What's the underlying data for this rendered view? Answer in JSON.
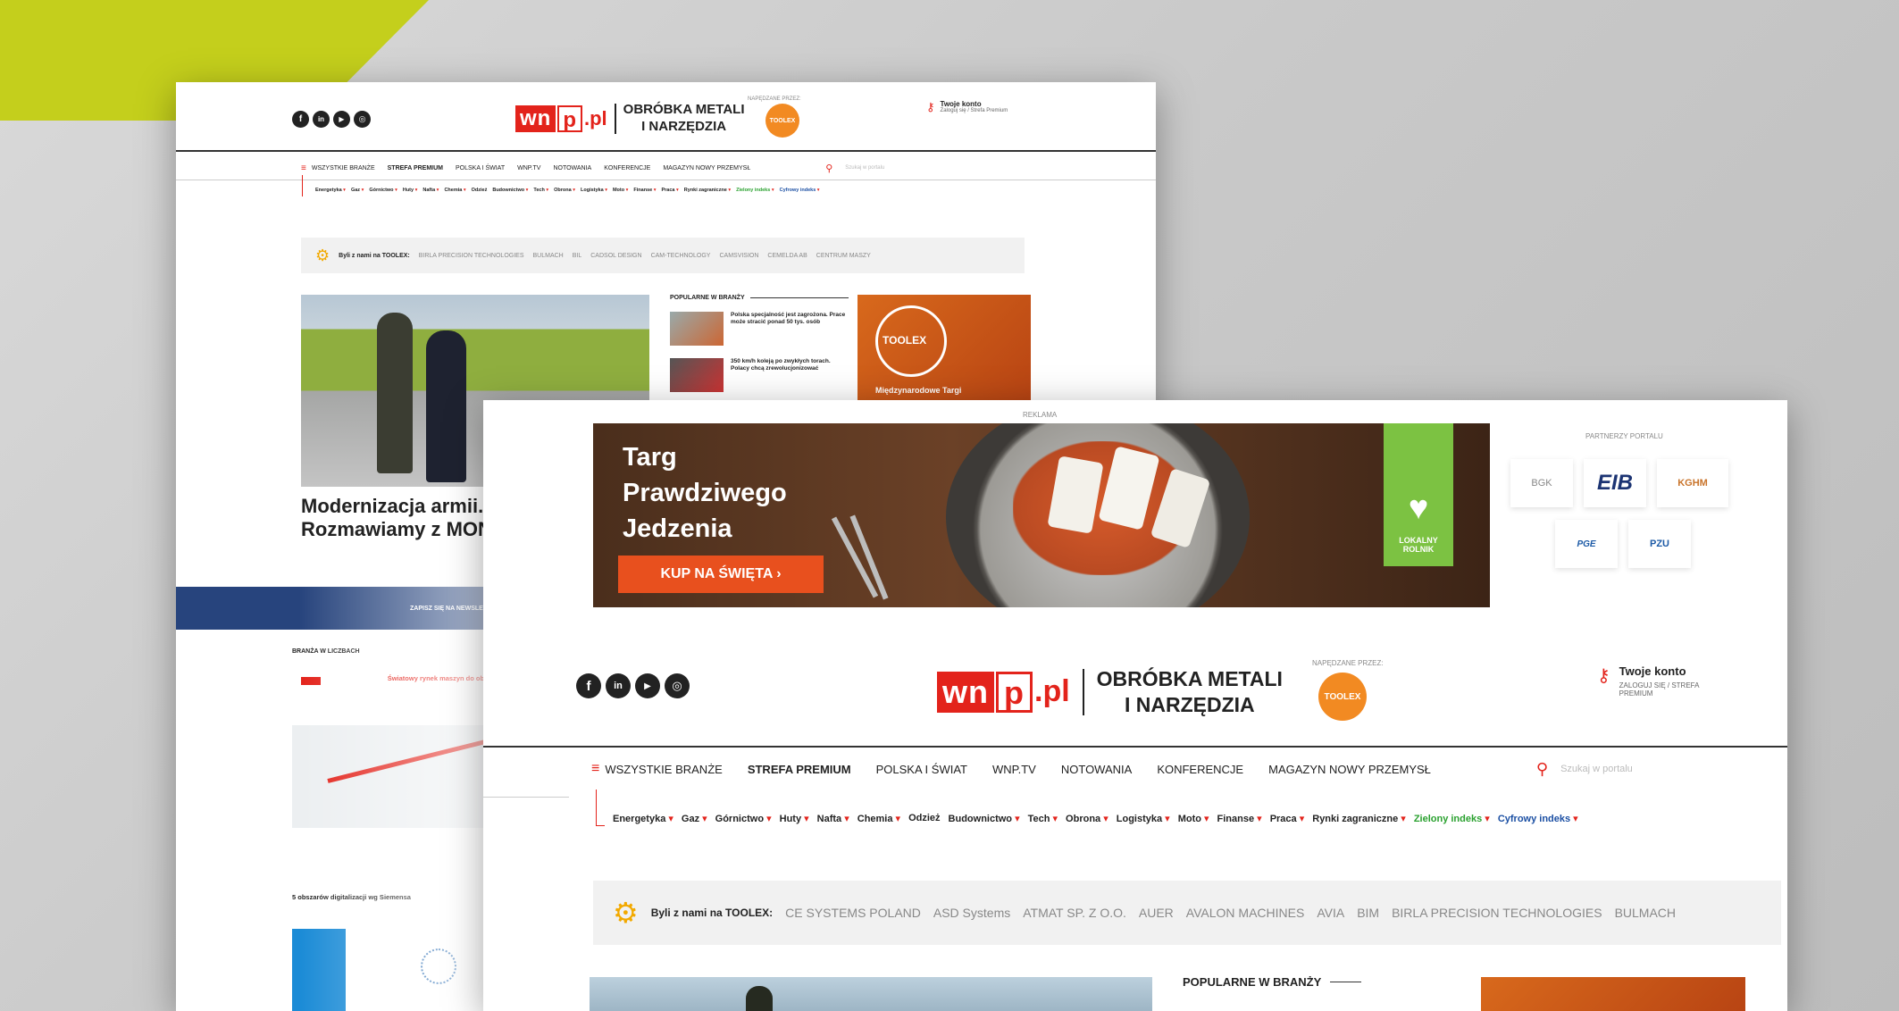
{
  "back": {
    "social": [
      "f",
      "in",
      "▶",
      "◎"
    ],
    "logo": {
      "wn": "wn",
      "p": "p",
      "pl": ".pl",
      "title_line1": "OBRÓBKA METALI",
      "title_line2": "I NARZĘDZIA",
      "powered": "NAPĘDZANE PRZEZ:"
    },
    "toolex": "TOOLEX",
    "account": {
      "title": "Twoje konto",
      "sub": "Zaloguj się / Strefa Premium"
    },
    "nav": {
      "menu": "≡",
      "items": [
        "WSZYSTKIE BRANŻE",
        "STREFA PREMIUM",
        "POLSKA I ŚWIAT",
        "WNP.TV",
        "NOTOWANIA",
        "KONFERENCJE",
        "MAGAZYN NOWY PRZEMYSŁ"
      ],
      "search_ph": "Szukaj w portalu"
    },
    "sub": [
      "Energetyka",
      "Gaz",
      "Górnictwo",
      "Huty",
      "Nafta",
      "Chemia",
      "Odzież",
      "Budownictwo",
      "Tech",
      "Obrona",
      "Logistyka",
      "Moto",
      "Finanse",
      "Praca",
      "Rynki zagraniczne",
      "Zielony indeks",
      "Cyfrowy indeks"
    ],
    "partners_lead": "Byli z nami na TOOLEX:",
    "partners": [
      "BIRLA PRECISION TECHNOLOGIES",
      "BULMACH",
      "BIL",
      "CADSOL DESIGN",
      "CAM-TECHNOLOGY",
      "CAMSVISION",
      "CEMELDA AB",
      "CENTRUM MASZY"
    ],
    "popular": {
      "heading": "POPULARNE W BRANŻY",
      "items": [
        "Polska specjalność jest zagrożona. Prace może stracić ponad 50 tys. osób",
        "350 km/h koleją po zwykłych torach. Polacy chcą zrewolucjonizować"
      ]
    },
    "promo_caption": "Międzynarodowe Targi",
    "headline": "Modernizacja armii. Rozmawiamy z MON",
    "bar_text": "ZAPISZ SIĘ NA NEWSLETTER",
    "section1": "BRANŻA W LICZBACH",
    "section1_text": "Światowy rynek maszyn do obróbki CNC (w mld USD)",
    "section2": "5 obszarów digitalizacji wg Siemensa"
  },
  "front": {
    "reklama": "REKLAMA",
    "ad": {
      "line1": "Targ",
      "line2": "Prawdziwego",
      "line3": "Jedzenia",
      "cta": "KUP NA ŚWIĘTA ›",
      "badge_line1": "LOKALNY",
      "badge_line2": "ROLNIK"
    },
    "partners_heading": "PARTNERZY PORTALU",
    "partner_logos": [
      "BGK",
      "EIB",
      "KGHM",
      "PGE",
      "PZU"
    ],
    "social": [
      "f",
      "in",
      "▶",
      "◎"
    ],
    "logo": {
      "wn": "wn",
      "p": "p",
      "pl": ".pl",
      "title_line1": "OBRÓBKA METALI",
      "title_line2": "I NARZĘDZIA",
      "powered": "NAPĘDZANE PRZEZ:"
    },
    "toolex": "TOOLEX",
    "account": {
      "title": "Twoje konto",
      "sub_line1": "ZALOGUJ SIĘ / STREFA",
      "sub_line2": "PREMIUM"
    },
    "nav": {
      "menu": "≡",
      "items": [
        "WSZYSTKIE BRANŻE",
        "STREFA PREMIUM",
        "POLSKA I ŚWIAT",
        "WNP.TV",
        "NOTOWANIA",
        "KONFERENCJE",
        "MAGAZYN NOWY PRZEMYSŁ"
      ],
      "search_ph": "Szukaj w portalu"
    },
    "sub": [
      "Energetyka",
      "Gaz",
      "Górnictwo",
      "Huty",
      "Nafta",
      "Chemia",
      "Odzież",
      "Budownictwo",
      "Tech",
      "Obrona",
      "Logistyka",
      "Moto",
      "Finanse",
      "Praca",
      "Rynki zagraniczne",
      "Zielony indeks",
      "Cyfrowy indeks"
    ],
    "partners_lead": "Byli z nami na TOOLEX:",
    "partners": [
      "CE SYSTEMS POLAND",
      "ASD Systems",
      "ATMAT SP. Z O.O.",
      "AUER",
      "AVALON MACHINES",
      "AVIA",
      "BIM",
      "BIRLA PRECISION TECHNOLOGIES",
      "BULMACH"
    ],
    "popular_heading": "POPULARNE W BRANŻY"
  },
  "colors": {
    "accent": "#e3231b",
    "lime": "#c4cf1c",
    "navy": "#27447d",
    "green": "#2aa12f",
    "blue": "#1b4fa3"
  }
}
